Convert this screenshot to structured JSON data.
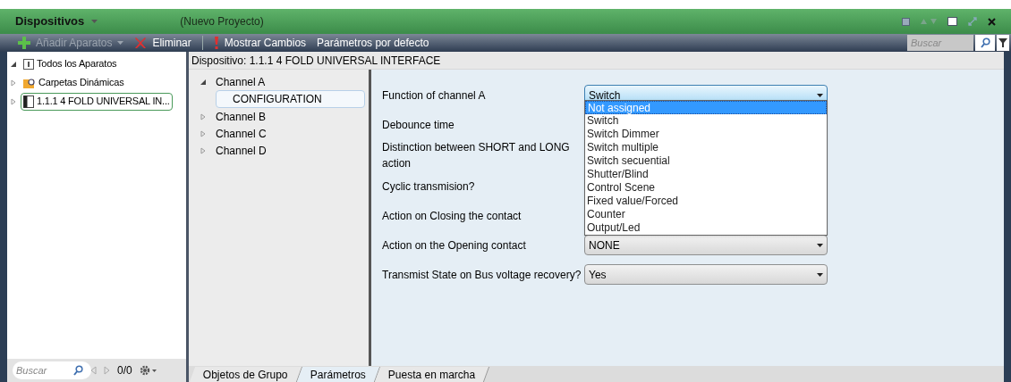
{
  "title_bar": {
    "title": "Dispositivos",
    "project": "(Nuevo Proyecto)"
  },
  "toolbar": {
    "items": [
      {
        "kind": "add",
        "label": "Añadir Aparatos",
        "disabled": true
      },
      {
        "kind": "delete",
        "label": "Eliminar",
        "disabled": false
      },
      {
        "kind": "changes",
        "label": "Mostrar Cambios",
        "disabled": false
      },
      {
        "kind": "plain",
        "label": "Parámetros por defecto",
        "disabled": false
      }
    ],
    "search": {
      "placeholder": "Buscar"
    }
  },
  "device_tree": {
    "items": [
      {
        "kind": "all",
        "label": "Todos los Aparatos",
        "expanded": true,
        "selected": false
      },
      {
        "kind": "folder",
        "label": "Carpetas Dinámicas",
        "expanded": false,
        "selected": false
      },
      {
        "kind": "device",
        "label": "1.1.1  4 FOLD UNIVERSAL IN...",
        "expanded": false,
        "selected": true
      }
    ]
  },
  "bottom_bar": {
    "search": {
      "placeholder": "Buscar"
    },
    "count": "0/0"
  },
  "device_header": "Dispositivo: 1.1.1  4 FOLD UNIVERSAL INTERFACE",
  "channels": [
    {
      "label": "Channel A",
      "expanded": true,
      "children": [
        {
          "label": "CONFIGURATION",
          "selected": true
        }
      ]
    },
    {
      "label": "Channel B",
      "expanded": false
    },
    {
      "label": "Channel C",
      "expanded": false
    },
    {
      "label": "Channel D",
      "expanded": false
    }
  ],
  "parameters": [
    {
      "label": "Function of channel A",
      "value": "Switch",
      "open": true,
      "options": [
        {
          "label": "Not assigned",
          "highlighted": true
        },
        {
          "label": "Switch",
          "highlighted": false
        },
        {
          "label": "Switch Dimmer",
          "highlighted": false
        },
        {
          "label": "Switch multiple",
          "highlighted": false
        },
        {
          "label": "Switch secuential",
          "highlighted": false
        },
        {
          "label": "Shutter/Blind",
          "highlighted": false
        },
        {
          "label": "Control Scene",
          "highlighted": false
        },
        {
          "label": "Fixed value/Forced",
          "highlighted": false
        },
        {
          "label": "Counter",
          "highlighted": false
        },
        {
          "label": "Output/Led",
          "highlighted": false
        }
      ]
    },
    {
      "label": "Debounce time"
    },
    {
      "label": "Distinction between SHORT and LONG action"
    },
    {
      "label": "Cyclic transmision?"
    },
    {
      "label": "Action on Closing the contact"
    },
    {
      "label": "Action on the Opening contact",
      "value": "NONE",
      "open": false
    },
    {
      "label": "Transmist State on Bus voltage recovery?",
      "value": "Yes",
      "open": false
    }
  ],
  "tabs": [
    {
      "label": "Objetos de Grupo",
      "selected": false
    },
    {
      "label": "Parámetros",
      "selected": true
    },
    {
      "label": "Puesta en marcha",
      "selected": false
    }
  ]
}
